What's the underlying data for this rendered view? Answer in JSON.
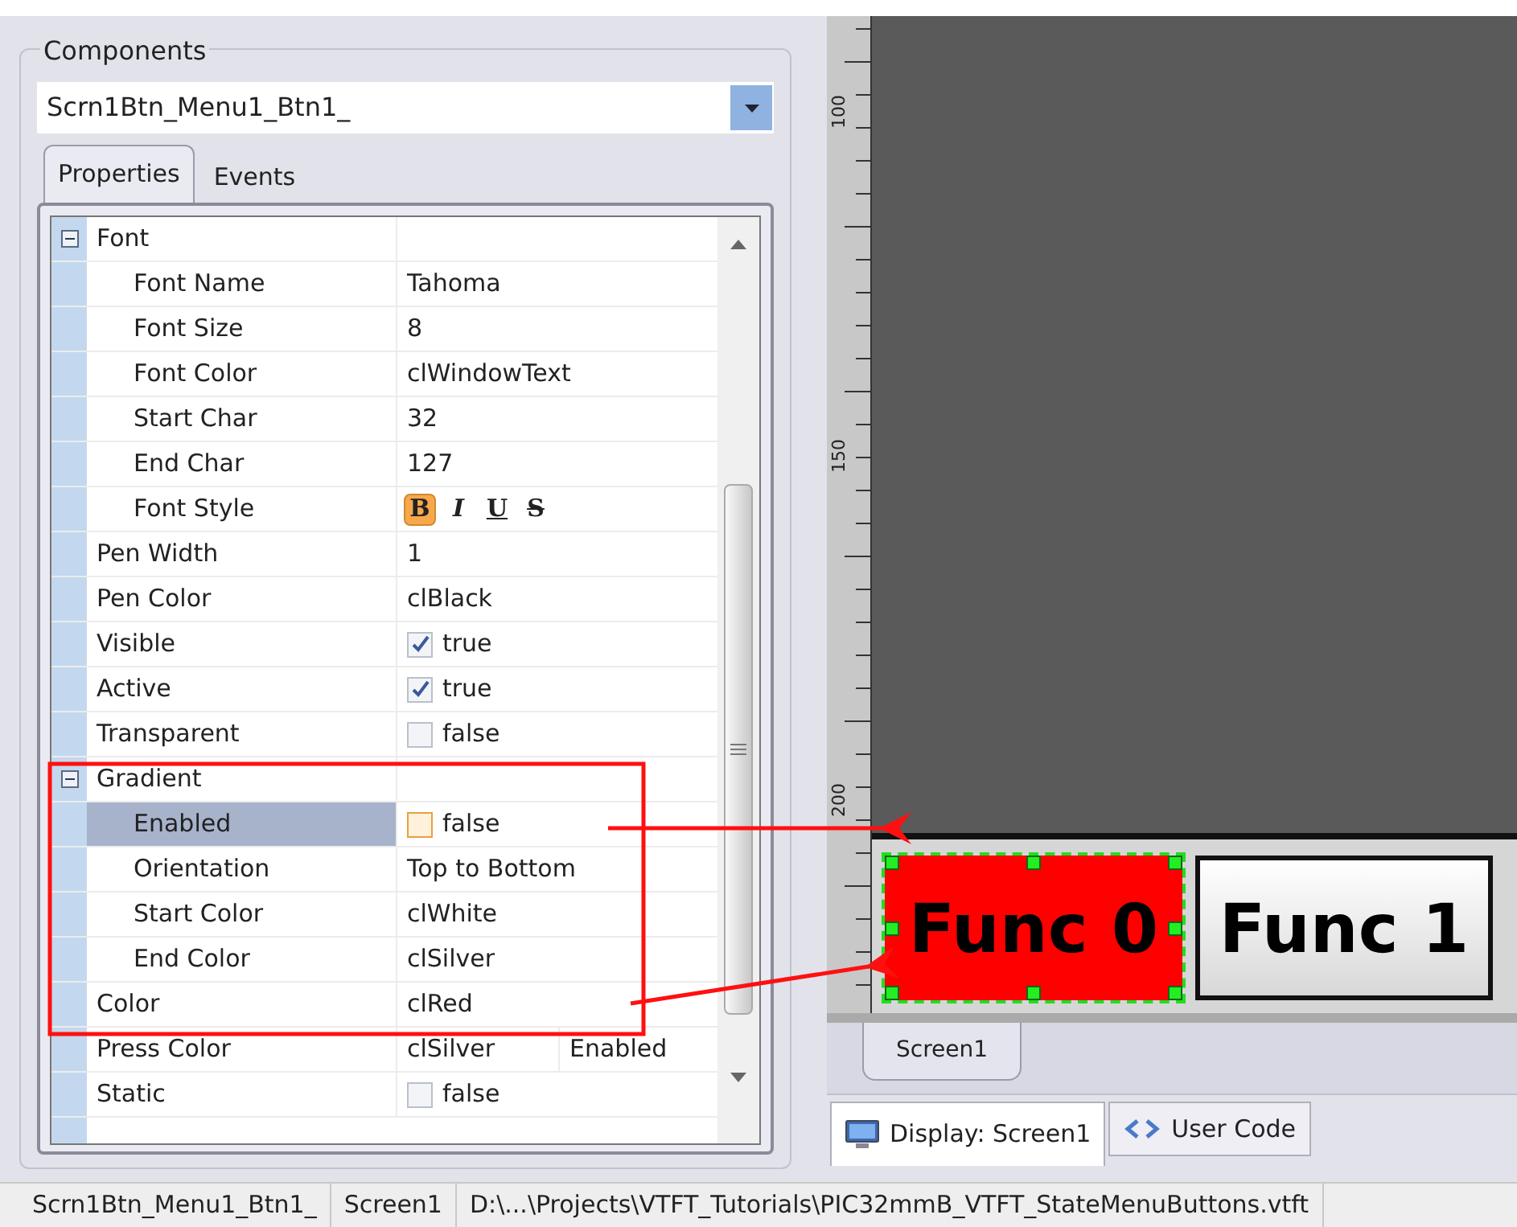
{
  "components": {
    "title": "Components",
    "selected": "Scrn1Btn_Menu1_Btn1_"
  },
  "tabs": [
    {
      "label": "Properties",
      "selected": true
    },
    {
      "label": "Events",
      "selected": false
    }
  ],
  "properties": [
    {
      "name": "Font",
      "kind": "group",
      "expanded": true,
      "selected": false,
      "children": [
        {
          "name": "Font Name",
          "kind": "text",
          "value": "Tahoma",
          "selected": false
        },
        {
          "name": "Font Size",
          "kind": "text",
          "value": "8",
          "selected": false
        },
        {
          "name": "Font Color",
          "kind": "text",
          "value": "clWindowText",
          "selected": false
        },
        {
          "name": "Start Char",
          "kind": "text",
          "value": "32",
          "selected": false
        },
        {
          "name": "End Char",
          "kind": "text",
          "value": "127",
          "selected": false
        },
        {
          "name": "Font Style",
          "kind": "fontstyle",
          "selected": false,
          "styles": [
            {
              "label": "B",
              "on": true
            },
            {
              "label": "I",
              "on": false
            },
            {
              "label": "U",
              "on": false
            },
            {
              "label": "S",
              "on": false
            }
          ]
        }
      ]
    },
    {
      "name": "Pen Width",
      "kind": "text",
      "value": "1",
      "selected": false
    },
    {
      "name": "Pen Color",
      "kind": "text",
      "value": "clBlack",
      "selected": false
    },
    {
      "name": "Visible",
      "kind": "check",
      "value": "true",
      "checked": true,
      "selected": false
    },
    {
      "name": "Active",
      "kind": "check",
      "value": "true",
      "checked": true,
      "selected": false
    },
    {
      "name": "Transparent",
      "kind": "check",
      "value": "false",
      "checked": false,
      "selected": false
    },
    {
      "name": "Gradient",
      "kind": "group",
      "expanded": true,
      "selected": false,
      "children": [
        {
          "name": "Enabled",
          "kind": "check",
          "value": "false",
          "checked": false,
          "selected": true
        },
        {
          "name": "Orientation",
          "kind": "text",
          "value": "Top to Bottom",
          "selected": false
        },
        {
          "name": "Start Color",
          "kind": "text",
          "value": "clWhite",
          "selected": false
        },
        {
          "name": "End Color",
          "kind": "text",
          "value": "clSilver",
          "selected": false
        }
      ]
    },
    {
      "name": "Color",
      "kind": "text",
      "value": "clRed",
      "selected": false
    },
    {
      "name": "Press Color",
      "kind": "text",
      "value": "clSilver",
      "extra": "Enabled",
      "selected": false
    },
    {
      "name": "Static",
      "kind": "check",
      "value": "false",
      "checked": false,
      "selected": false
    }
  ],
  "ruler": {
    "labels": [
      "100",
      "150",
      "200"
    ]
  },
  "canvas": {
    "buttons": [
      {
        "label": "Func 0",
        "color": "#ff0000",
        "selected": true
      },
      {
        "label": "Func 1",
        "color": "#d8d8d8",
        "selected": false
      }
    ]
  },
  "screen_tabs": [
    {
      "label": "Screen1",
      "selected": true
    }
  ],
  "view_tabs": [
    {
      "label": "Display: Screen1",
      "kind": "display",
      "selected": true
    },
    {
      "label": "User Code",
      "kind": "code",
      "selected": false
    }
  ],
  "status_bar": [
    "Scrn1Btn_Menu1_Btn1_",
    "Screen1",
    "D:\\...\\Projects\\VTFT_Tutorials\\PIC32mmB_VTFT_StateMenuButtons.vtft"
  ]
}
